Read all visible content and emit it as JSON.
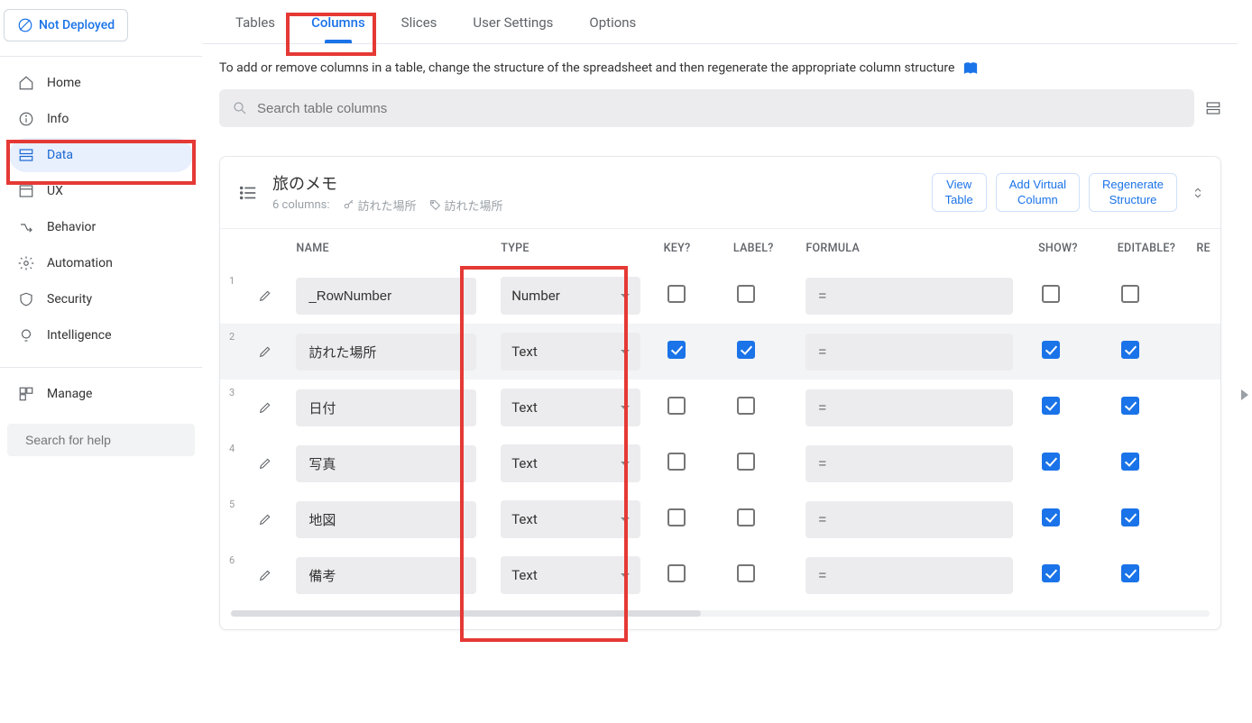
{
  "deploy_badge": "Not Deployed",
  "sidebar": {
    "items": [
      {
        "label": "Home"
      },
      {
        "label": "Info"
      },
      {
        "label": "Data"
      },
      {
        "label": "UX"
      },
      {
        "label": "Behavior"
      },
      {
        "label": "Automation"
      },
      {
        "label": "Security"
      },
      {
        "label": "Intelligence"
      }
    ],
    "manage": "Manage",
    "help_placeholder": "Search for help"
  },
  "tabs": {
    "items": [
      "Tables",
      "Columns",
      "Slices",
      "User Settings",
      "Options"
    ],
    "active_index": 1
  },
  "hint": "To add or remove columns in a table, change the structure of the spreadsheet and then regenerate the appropriate column structure",
  "search": {
    "placeholder": "Search table columns"
  },
  "card": {
    "title": "旅のメモ",
    "column_count": "6",
    "column_count_label": "columns:",
    "key_ref": "訪れた場所",
    "label_ref": "訪れた場所",
    "actions": {
      "view_table": "View Table",
      "add_virtual": "Add Virtual Column",
      "regenerate": "Regenerate Structure"
    }
  },
  "table": {
    "headers": {
      "name": "NAME",
      "type": "TYPE",
      "key": "KEY?",
      "label": "LABEL?",
      "formula": "FORMULA",
      "show": "SHOW?",
      "editable": "EDITABLE?",
      "re": "RE"
    },
    "rows": [
      {
        "idx": "1",
        "name": "_RowNumber",
        "type": "Number",
        "key": false,
        "label": false,
        "formula": "=",
        "show": false,
        "editable": false
      },
      {
        "idx": "2",
        "name": "訪れた場所",
        "type": "Text",
        "key": true,
        "label": true,
        "formula": "=",
        "show": true,
        "editable": true
      },
      {
        "idx": "3",
        "name": "日付",
        "type": "Text",
        "key": false,
        "label": false,
        "formula": "=",
        "show": true,
        "editable": true
      },
      {
        "idx": "4",
        "name": "写真",
        "type": "Text",
        "key": false,
        "label": false,
        "formula": "=",
        "show": true,
        "editable": true
      },
      {
        "idx": "5",
        "name": "地図",
        "type": "Text",
        "key": false,
        "label": false,
        "formula": "=",
        "show": true,
        "editable": true
      },
      {
        "idx": "6",
        "name": "備考",
        "type": "Text",
        "key": false,
        "label": false,
        "formula": "=",
        "show": true,
        "editable": true
      }
    ]
  }
}
